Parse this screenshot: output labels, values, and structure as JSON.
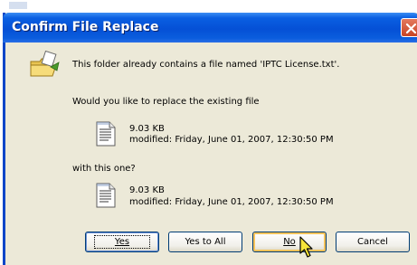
{
  "dialog": {
    "title": "Confirm File Replace",
    "message": "This folder already contains a file named 'IPTC License.txt'.",
    "question": "Would you like to replace the existing file",
    "existing_file": {
      "size": "9.03 KB",
      "modified": "modified: Friday, June 01, 2007, 12:30:50 PM"
    },
    "with_label": "with this one?",
    "new_file": {
      "size": "9.03 KB",
      "modified": "modified: Friday, June 01, 2007, 12:30:50 PM"
    }
  },
  "buttons": {
    "yes": "Yes",
    "yes_to_all": "Yes to All",
    "no": "No",
    "cancel": "Cancel"
  },
  "colors": {
    "titlebar": "#0550d6",
    "dialog_bg": "#ece9d8",
    "close": "#c84424"
  },
  "icons": [
    "folder-move-icon",
    "text-file-icon",
    "close-icon",
    "mouse-pointer-icon"
  ]
}
